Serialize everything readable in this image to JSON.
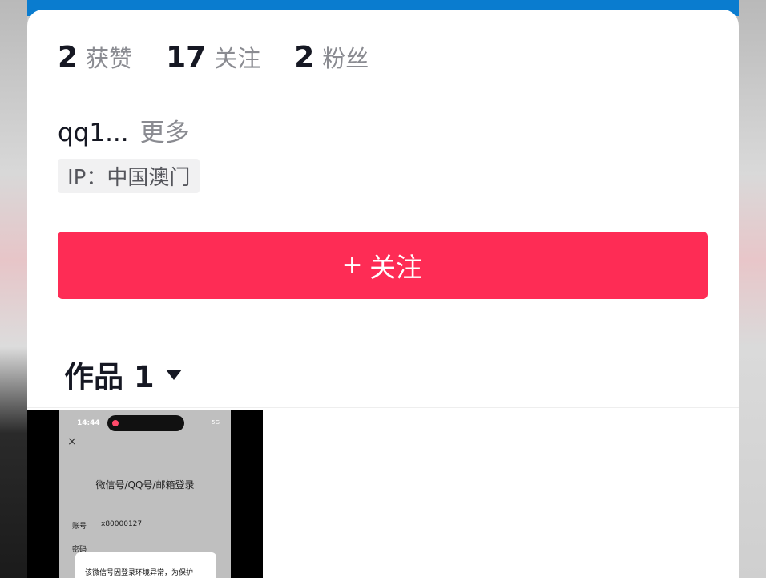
{
  "profile": {
    "stats": [
      {
        "value": "2",
        "label": "获赞"
      },
      {
        "value": "17",
        "label": "关注"
      },
      {
        "value": "2",
        "label": "粉丝"
      }
    ],
    "bio_text": "qq1...",
    "bio_more": "更多",
    "ip_location": "IP：中国澳门"
  },
  "follow_button": {
    "plus": "+",
    "label": "关注"
  },
  "works": {
    "title": "作品 1"
  },
  "thumbnail": {
    "time": "14:44",
    "status": "5G",
    "close": "×",
    "title": "微信号/QQ号/邮箱登录",
    "account_label": "账号",
    "account_value": "x80000127",
    "password_label": "密码",
    "dialog_text": "该微信号因登录环境异常，为保护"
  },
  "colors": {
    "accent": "#fe2c55",
    "top_bar": "#0a7ccf",
    "text_primary": "#161823",
    "text_secondary": "#8a8b91"
  }
}
